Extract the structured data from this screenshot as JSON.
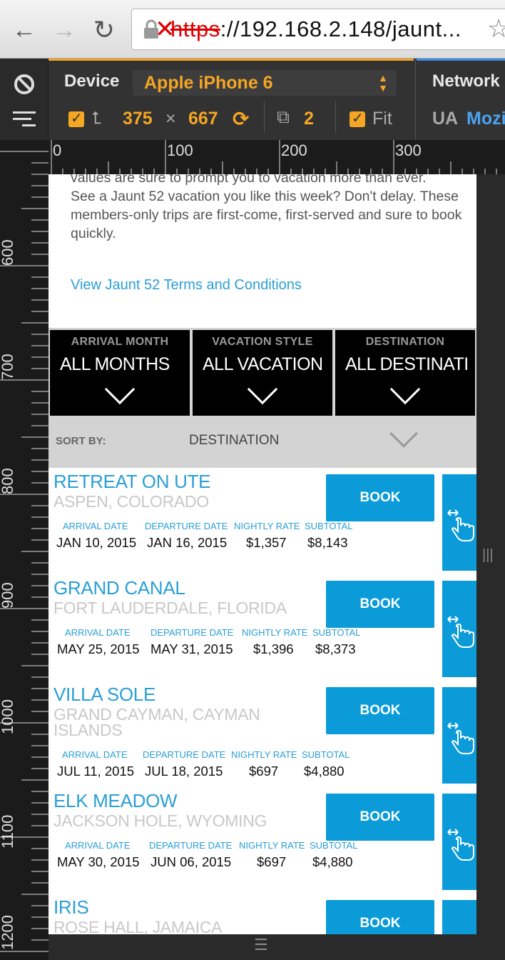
{
  "browser": {
    "url_scheme": "https",
    "url_rest": "://192.168.2.148/jaunt..."
  },
  "devtools": {
    "device_label": "Device",
    "device_value": "Apple iPhone 6",
    "width": "375",
    "times": "×",
    "height": "667",
    "scale": "2",
    "fit_label": "Fit",
    "network_label": "Network",
    "ua_label": "UA",
    "ua_value": "Mozi"
  },
  "rulers": {
    "top": [
      "0",
      "100",
      "200",
      "300"
    ],
    "left": [
      "600",
      "700",
      "800",
      "900",
      "1000",
      "1100",
      "1200"
    ]
  },
  "intro": {
    "line1": "values are sure to prompt you to vacation more than ever.",
    "line2": "See a Jaunt 52 vacation you like this week? Don't delay. These members-only trips are first-come, first-served and sure to book quickly.",
    "terms_link": "View Jaunt 52 Terms and Conditions"
  },
  "filters": [
    {
      "title": "ARRIVAL MONTH",
      "value": "ALL MONTHS"
    },
    {
      "title": "VACATION STYLE",
      "value": "ALL VACATION"
    },
    {
      "title": "DESTINATION",
      "value": "ALL DESTINATI"
    }
  ],
  "sort": {
    "label": "SORT BY:",
    "value": "DESTINATION"
  },
  "listing_headers": {
    "arrival": "ARRIVAL DATE",
    "departure": "DEPARTURE DATE",
    "rate": "NIGHTLY RATE",
    "subtotal": "SUBTOTAL"
  },
  "book_label": "BOOK",
  "listings": [
    {
      "name": "RETREAT ON UTE",
      "location": "ASPEN, COLORADO",
      "arrival": "JAN 10, 2015",
      "departure": "JAN 16, 2015",
      "rate": "$1,357",
      "subtotal": "$8,143"
    },
    {
      "name": "GRAND CANAL",
      "location": "FORT LAUDERDALE, FLORIDA",
      "arrival": "MAY 25, 2015",
      "departure": "MAY 31, 2015",
      "rate": "$1,396",
      "subtotal": "$8,373"
    },
    {
      "name": "VILLA SOLE",
      "location": "GRAND CAYMAN, CAYMAN ISLANDS",
      "arrival": "JUL 11, 2015",
      "departure": "JUL 18, 2015",
      "rate": "$697",
      "subtotal": "$4,880"
    },
    {
      "name": "ELK MEADOW",
      "location": "JACKSON HOLE, WYOMING",
      "arrival": "MAY 30, 2015",
      "departure": "JUN 06, 2015",
      "rate": "$697",
      "subtotal": "$4,880"
    },
    {
      "name": "IRIS",
      "location": "ROSE HALL, JAMAICA",
      "arrival": "",
      "departure": "",
      "rate": "",
      "subtotal": ""
    }
  ],
  "colors": {
    "accent_blue": "#0a9bd8",
    "devtools_orange": "#f5a623"
  }
}
